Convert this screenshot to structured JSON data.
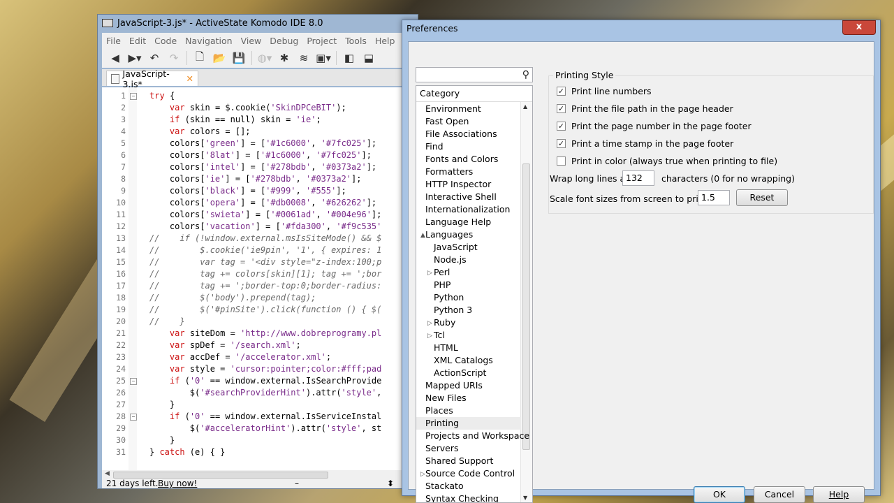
{
  "komodo": {
    "title": "JavaScript-3.js* - ActiveState Komodo IDE 8.0",
    "menu": [
      "File",
      "Edit",
      "Code",
      "Navigation",
      "View",
      "Debug",
      "Project",
      "Tools",
      "Help"
    ],
    "tab_label": "JavaScript-3.js*",
    "status_text": "21 days left.",
    "buy_link": "Buy now!",
    "status_dash": "–",
    "status_updown": "⬍",
    "lines": [
      {
        "n": "1",
        "text": "try {"
      },
      {
        "n": "2",
        "text": "    var skin = $.cookie('SkinDPCeBIT');"
      },
      {
        "n": "3",
        "text": "    if (skin == null) skin = 'ie';"
      },
      {
        "n": "4",
        "text": "    var colors = [];"
      },
      {
        "n": "5",
        "text": "    colors['green'] = ['#1c6000', '#7fc025'];"
      },
      {
        "n": "6",
        "text": "    colors['8lat'] = ['#1c6000', '#7fc025'];"
      },
      {
        "n": "7",
        "text": "    colors['intel'] = ['#278bdb', '#0373a2'];"
      },
      {
        "n": "8",
        "text": "    colors['ie'] = ['#278bdb', '#0373a2'];"
      },
      {
        "n": "9",
        "text": "    colors['black'] = ['#999', '#555'];"
      },
      {
        "n": "10",
        "text": "    colors['opera'] = ['#db0008', '#626262'];"
      },
      {
        "n": "11",
        "text": "    colors['swieta'] = ['#0061ad', '#004e96'];"
      },
      {
        "n": "12",
        "text": "    colors['vacation'] = ['#fda300', '#f9c535'"
      },
      {
        "n": "13",
        "text": "//    if (!window.external.msIsSiteMode() && $"
      },
      {
        "n": "14",
        "text": "//        $.cookie('ie9pin', '1', { expires: 1"
      },
      {
        "n": "15",
        "text": "//        var tag = '<div style=\"z-index:100;p"
      },
      {
        "n": "16",
        "text": "//        tag += colors[skin][1]; tag += ';bor"
      },
      {
        "n": "17",
        "text": "//        tag += ';border-top:0;border-radius:"
      },
      {
        "n": "18",
        "text": "//        $('body').prepend(tag);"
      },
      {
        "n": "19",
        "text": "//        $('#pinSite').click(function () { $("
      },
      {
        "n": "20",
        "text": "//    }"
      },
      {
        "n": "21",
        "text": "    var siteDom = 'http://www.dobreprogramy.pl"
      },
      {
        "n": "22",
        "text": "    var spDef = '/search.xml';"
      },
      {
        "n": "23",
        "text": "    var accDef = '/accelerator.xml';"
      },
      {
        "n": "24",
        "text": "    var style = 'cursor:pointer;color:#fff;pad"
      },
      {
        "n": "25",
        "text": "    if ('0' == window.external.IsSearchProvide"
      },
      {
        "n": "26",
        "text": "        $('#searchProviderHint').attr('style',"
      },
      {
        "n": "27",
        "text": "    }"
      },
      {
        "n": "28",
        "text": "    if ('0' == window.external.IsServiceInstal"
      },
      {
        "n": "29",
        "text": "        $('#acceleratorHint').attr('style', st"
      },
      {
        "n": "30",
        "text": "    }"
      },
      {
        "n": "31",
        "text": "} catch (e) { }"
      }
    ]
  },
  "prefs": {
    "title": "Preferences",
    "close": "x",
    "search_placeholder": "",
    "category_header": "Category",
    "categories": [
      {
        "label": "Environment",
        "indent": 0,
        "twist": ""
      },
      {
        "label": "Fast Open",
        "indent": 0,
        "twist": ""
      },
      {
        "label": "File Associations",
        "indent": 0,
        "twist": ""
      },
      {
        "label": "Find",
        "indent": 0,
        "twist": ""
      },
      {
        "label": "Fonts and Colors",
        "indent": 0,
        "twist": ""
      },
      {
        "label": "Formatters",
        "indent": 0,
        "twist": ""
      },
      {
        "label": "HTTP Inspector",
        "indent": 0,
        "twist": ""
      },
      {
        "label": "Interactive Shell",
        "indent": 0,
        "twist": ""
      },
      {
        "label": "Internationalization",
        "indent": 0,
        "twist": ""
      },
      {
        "label": "Language Help",
        "indent": 0,
        "twist": ""
      },
      {
        "label": "Languages",
        "indent": 0,
        "twist": "▲"
      },
      {
        "label": "JavaScript",
        "indent": 1,
        "twist": ""
      },
      {
        "label": "Node.js",
        "indent": 1,
        "twist": ""
      },
      {
        "label": "Perl",
        "indent": 1,
        "twist": "▷"
      },
      {
        "label": "PHP",
        "indent": 1,
        "twist": ""
      },
      {
        "label": "Python",
        "indent": 1,
        "twist": ""
      },
      {
        "label": "Python 3",
        "indent": 1,
        "twist": ""
      },
      {
        "label": "Ruby",
        "indent": 1,
        "twist": "▷"
      },
      {
        "label": "Tcl",
        "indent": 1,
        "twist": "▷"
      },
      {
        "label": "HTML",
        "indent": 1,
        "twist": ""
      },
      {
        "label": "XML Catalogs",
        "indent": 1,
        "twist": ""
      },
      {
        "label": "ActionScript",
        "indent": 1,
        "twist": ""
      },
      {
        "label": "Mapped URIs",
        "indent": 0,
        "twist": ""
      },
      {
        "label": "New Files",
        "indent": 0,
        "twist": ""
      },
      {
        "label": "Places",
        "indent": 0,
        "twist": ""
      },
      {
        "label": "Printing",
        "indent": 0,
        "twist": "",
        "selected": true
      },
      {
        "label": "Projects and Workspace",
        "indent": 0,
        "twist": ""
      },
      {
        "label": "Servers",
        "indent": 0,
        "twist": ""
      },
      {
        "label": "Shared Support",
        "indent": 0,
        "twist": ""
      },
      {
        "label": "Source Code Control",
        "indent": 0,
        "twist": "▷"
      },
      {
        "label": "Stackato",
        "indent": 0,
        "twist": ""
      },
      {
        "label": "Syntax Checking",
        "indent": 0,
        "twist": ""
      }
    ],
    "group_label": "Printing Style",
    "checkboxes": [
      {
        "label": "Print line numbers",
        "checked": true
      },
      {
        "label": "Print the file path in the page header",
        "checked": true
      },
      {
        "label": "Print the page number in the page footer",
        "checked": true
      },
      {
        "label": "Print a time stamp in the page footer",
        "checked": true
      },
      {
        "label": "Print in color (always true when printing to file)",
        "checked": false
      }
    ],
    "wrap_label": "Wrap long lines at",
    "wrap_value": "132",
    "wrap_suffix": "characters (0 for no wrapping)",
    "scale_label": "Scale font sizes from screen to print by",
    "scale_value": "1.5",
    "reset_label": "Reset",
    "ok_label": "OK",
    "cancel_label": "Cancel",
    "help_label": "Help"
  }
}
